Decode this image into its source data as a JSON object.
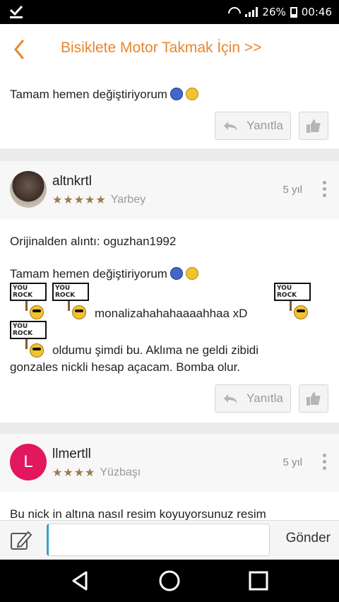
{
  "status": {
    "battery": "26%",
    "time": "00:46"
  },
  "header": {
    "title": "Bisiklete Motor Takmak İçin >>"
  },
  "posts": [
    {
      "text": "Tamam hemen değiştiriyorum",
      "reply_label": "Yanıtla"
    },
    {
      "username": "altnkrtl",
      "rank": "Yarbey",
      "time": "5 yıl",
      "stars": 5,
      "quote_line": "Orijinalden alıntı: oguzhan1992",
      "line1": "Tamam hemen değiştiriyorum",
      "line2": "monalizahahahaaaahhaa xD",
      "line3": "oldumu şimdi bu. Aklıma ne geldi zibidi",
      "line4": "gonzales nickli hesap açacam. Bomba olur.",
      "reply_label": "Yanıtla",
      "sign_text": "YOU ROCK"
    },
    {
      "avatar_letter": "L",
      "username": "llmertll",
      "rank": "Yüzbaşı",
      "time": "5 yıl",
      "stars": 4,
      "preview": "Bu nick in altına nasıl resim koyuyorsunuz resim"
    }
  ],
  "composer": {
    "placeholder": "",
    "send_label": "Gönder"
  },
  "colors": {
    "accent": "#e8862e",
    "avatar_l": "#e3175e"
  },
  "icons": [
    "download-icon",
    "wifi-icon",
    "signal-icon",
    "battery-icon",
    "back-icon",
    "reply-icon",
    "thumbs-up-icon",
    "more-vert-icon",
    "edit-icon",
    "nav-back-icon",
    "nav-home-icon",
    "nav-recents-icon"
  ]
}
